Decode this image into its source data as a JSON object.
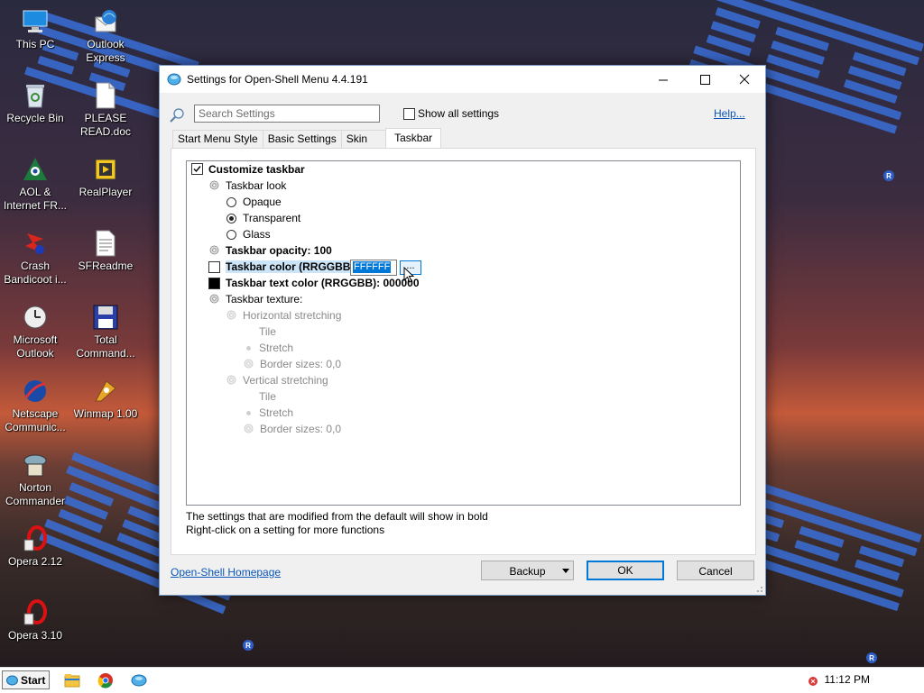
{
  "desktop": {
    "icons": [
      {
        "label": "This PC",
        "icon": "computer-icon"
      },
      {
        "label": "Outlook Express",
        "icon": "outlook-express-icon"
      },
      {
        "label": "Recycle Bin",
        "icon": "recycle-bin-icon"
      },
      {
        "label": "PLEASE READ.doc",
        "icon": "document-icon"
      },
      {
        "label": "AOL & Internet FR...",
        "icon": "aol-icon"
      },
      {
        "label": "RealPlayer",
        "icon": "realplayer-icon"
      },
      {
        "label": "Crash Bandicoot i...",
        "icon": "crash-bandicoot-icon"
      },
      {
        "label": "SFReadme",
        "icon": "text-file-icon"
      },
      {
        "label": "Microsoft Outlook",
        "icon": "ms-outlook-icon"
      },
      {
        "label": "Total Command...",
        "icon": "floppy-disk-icon"
      },
      {
        "label": "Netscape Communic...",
        "icon": "netscape-icon"
      },
      {
        "label": "Winmap 1.00",
        "icon": "winmap-icon"
      },
      {
        "label": "Norton Commander",
        "icon": "norton-commander-icon"
      },
      {
        "label": "Opera 2.12",
        "icon": "opera-icon"
      },
      {
        "label": "Opera 3.10",
        "icon": "opera-icon"
      }
    ]
  },
  "dialog": {
    "title": "Settings for Open-Shell Menu 4.4.191",
    "search_placeholder": "Search Settings",
    "show_all_label": "Show all settings",
    "help_label": "Help...",
    "tabs": [
      {
        "label": "Start Menu Style"
      },
      {
        "label": "Basic Settings"
      },
      {
        "label": "Skin"
      },
      {
        "label": "Taskbar"
      }
    ],
    "tree": {
      "customize_taskbar": "Customize taskbar",
      "taskbar_look": "Taskbar look",
      "opaque": "Opaque",
      "transparent": "Transparent",
      "glass": "Glass",
      "taskbar_opacity": "Taskbar opacity: 100",
      "taskbar_color": "Taskbar color (RRGGBB)",
      "taskbar_color_value": "FFFFFF",
      "taskbar_color_dots": "...",
      "taskbar_text_color": "Taskbar text color (RRGGBB): 000000",
      "taskbar_texture": "Taskbar texture:",
      "horizontal_stretching": "Horizontal stretching",
      "h_tile": "Tile",
      "h_stretch": "Stretch",
      "h_border": "Border sizes: 0,0",
      "vertical_stretching": "Vertical stretching",
      "v_tile": "Tile",
      "v_stretch": "Stretch",
      "v_border": "Border sizes: 0,0"
    },
    "hint_line1": "The settings that are modified from the default will show in bold",
    "hint_line2": "Right-click on a setting for more functions",
    "homepage_label": "Open-Shell Homepage",
    "backup_label": "Backup",
    "ok_label": "OK",
    "cancel_label": "Cancel"
  },
  "taskbar": {
    "start_label": "Start",
    "clock": "11:12 PM"
  },
  "colors": {
    "accent": "#0078d7",
    "link": "#0b56b8",
    "ibm_blue": "#3a6fd8"
  }
}
